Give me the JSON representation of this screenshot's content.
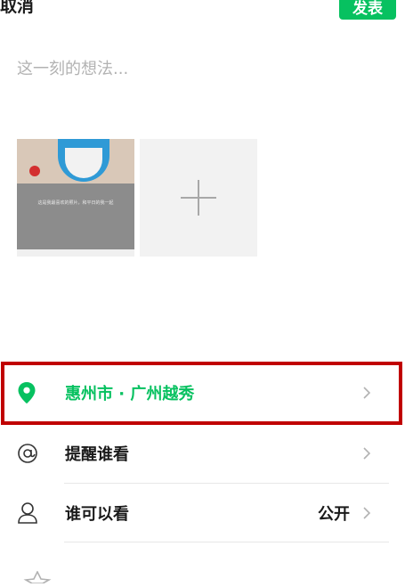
{
  "header": {
    "cancel_label": "取消",
    "publish_label": "发表"
  },
  "composer": {
    "placeholder": "这一刻的想法..."
  },
  "photos": {
    "thumbnail_caption": "这是我最喜欢的照片，和平日的我一起",
    "add_icon": "plus-icon"
  },
  "options": [
    {
      "icon": "location-pin-icon",
      "label": "惠州市 · 广州越秀",
      "value": "",
      "highlighted": true
    },
    {
      "icon": "at-icon",
      "label": "提醒谁看",
      "value": ""
    },
    {
      "icon": "person-icon",
      "label": "谁可以看",
      "value": "公开"
    }
  ],
  "colors": {
    "brand_green": "#07c160",
    "highlight_red": "#c00000"
  }
}
